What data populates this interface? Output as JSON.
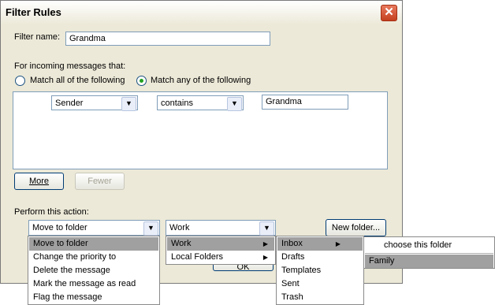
{
  "window": {
    "title": "Filter Rules",
    "close_glyph": "✕"
  },
  "filter_name": {
    "label": "Filter name:",
    "value": "Grandma"
  },
  "incoming": {
    "label": "For incoming messages that:"
  },
  "match": {
    "all_label": "Match all of the following",
    "any_label": "Match any of the following",
    "selected": "any"
  },
  "rule": {
    "field": "Sender",
    "operator": "contains",
    "value": "Grandma"
  },
  "buttons": {
    "more": "More",
    "fewer": "Fewer",
    "new_folder": "New folder...",
    "ok": "OK"
  },
  "action": {
    "label": "Perform this action:",
    "selected": "Move to folder",
    "options": [
      "Move to folder",
      "Change the priority to",
      "Delete the message",
      "Mark the message as read",
      "Flag the message"
    ]
  },
  "folder": {
    "selected": "Work",
    "accounts": [
      "Work",
      "Local Folders"
    ],
    "work_folders": [
      "Inbox",
      "Drafts",
      "Templates",
      "Sent",
      "Trash"
    ],
    "inbox_submenu": [
      "choose this folder",
      "Family"
    ]
  },
  "icons": {
    "dropdown": "chevron-down-icon",
    "submenu": "chevron-right-icon"
  }
}
